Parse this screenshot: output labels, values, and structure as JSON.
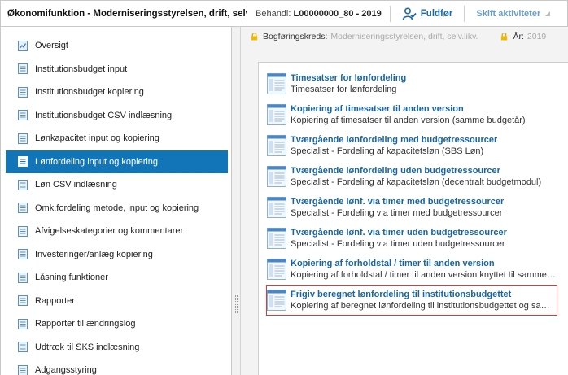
{
  "header": {
    "title": "Økonomifunktion - Moderniseringsstyrelsen, drift, selv.likv.",
    "behandl_label": "Behandl:",
    "behandl_value": "L00000000_80 - 2019",
    "fuldfor_label": "Fuldfør",
    "skift_label": "Skift aktiviteter"
  },
  "sidebar": {
    "items": [
      {
        "label": "Oversigt"
      },
      {
        "label": "Institutionsbudget input"
      },
      {
        "label": "Institutionsbudget kopiering"
      },
      {
        "label": "Institutionsbudget CSV indlæsning"
      },
      {
        "label": "Lønkapacitet input og kopiering"
      },
      {
        "label": "Lønfordeling input og kopiering"
      },
      {
        "label": "Løn CSV indlæsning"
      },
      {
        "label": "Omk.fordeling metode, input og kopiering"
      },
      {
        "label": "Afvigelseskategorier og kommentarer"
      },
      {
        "label": "Investeringer/anlæg kopiering"
      },
      {
        "label": "Låsning funktioner"
      },
      {
        "label": "Rapporter"
      },
      {
        "label": "Rapporter til ændringslog"
      },
      {
        "label": "Udtræk til SKS indlæsning"
      },
      {
        "label": "Adgangsstyring"
      }
    ]
  },
  "context": {
    "kreds_label": "Bogføringskreds:",
    "kreds_value": "Moderniseringsstyrelsen, drift, selv.likv.",
    "aar_label": "År:",
    "aar_value": "2019"
  },
  "activities": [
    {
      "title": "Timesatser for lønfordeling",
      "subtitle": "Timesatser for lønfordeling"
    },
    {
      "title": "Kopiering af timesatser til anden version",
      "subtitle": "Kopiering af timesatser til anden version (samme budgetår)"
    },
    {
      "title": "Tværgående lønfordeling med budgetressourcer",
      "subtitle": "Specialist - Fordeling af kapacitetsløn (SBS Løn)"
    },
    {
      "title": "Tværgående lønfordeling uden budgetressourcer",
      "subtitle": "Specialist - Fordeling af kapacitetsløn (decentralt budgetmodul)"
    },
    {
      "title": "Tværgående lønf. via timer med budgetressourcer",
      "subtitle": "Specialist - Fordeling via timer med budgetressourcer"
    },
    {
      "title": "Tværgående lønf. via timer uden budgetressourcer",
      "subtitle": "Specialist - Fordeling via timer uden budgetressourcer"
    },
    {
      "title": "Kopiering af forholdstal / timer til anden version",
      "subtitle": "Kopiering af forholdstal / timer til anden version knyttet til samme budgetår"
    },
    {
      "title": "Frigiv beregnet lønfordeling til institutionsbudgettet",
      "subtitle": "Kopiering af beregnet lønfordeling til institutionsbudgettet og samme budgetår"
    }
  ],
  "colors": {
    "accent": "#1275b8",
    "link": "#1565a6",
    "highlight": "#d93a3a"
  }
}
